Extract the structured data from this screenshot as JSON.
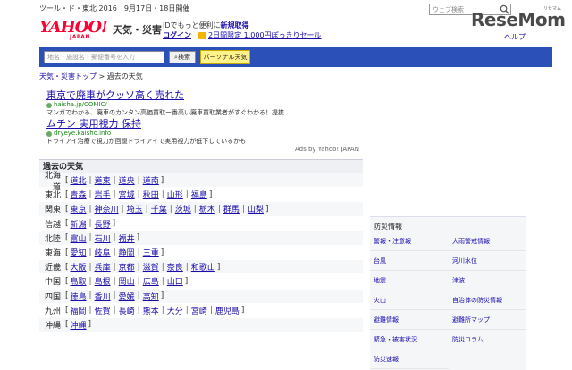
{
  "header": {
    "promo_line": "ツール・ド・東北 2016　9月17日・18日開催",
    "search_placeholder": "ウェブ検索",
    "help": "ヘルプ",
    "logo_main": "YAHOO!",
    "logo_sub": "JAPAN",
    "site_title": "天気・災害",
    "id_promo": "IDでもっと便利に",
    "new_registration": "新規取得",
    "login": "ログイン",
    "cart_promo": "2日間限定 1,000円ぽっきりセール",
    "watermark": "ReseMom",
    "watermark_ruby": "リセマム"
  },
  "nav": {
    "input_placeholder": "地名・施設名・郵便番号を入力",
    "search_button": "検索",
    "personal_button": "パーソナル天気"
  },
  "breadcrumb": {
    "top": "天気・災害トップ",
    "separator": ">",
    "current": "過去の天気"
  },
  "ads": [
    {
      "title": "東京で廃車がクッソ高く売れた",
      "url": "haisha.jp/COMIC/",
      "desc": "マンガでわかる、廃車のカンタン高価買取ー番高い廃車買取業者がすぐわかる！提携"
    },
    {
      "title": "ムチン 実用視力 保持",
      "url": "dryeye.kaisho.info",
      "desc": "ドライアイ治療で視力が回復ドライアイで実用視力が低下しているかも"
    }
  ],
  "ads_by": "Ads by Yahoo! JAPAN",
  "past_weather": {
    "title": "過去の天気",
    "regions": [
      {
        "name": "北海道",
        "prefs": [
          "道北",
          "道東",
          "道央",
          "道南"
        ]
      },
      {
        "name": "東北",
        "prefs": [
          "青森",
          "岩手",
          "宮城",
          "秋田",
          "山形",
          "福島"
        ]
      },
      {
        "name": "関東",
        "prefs": [
          "東京",
          "神奈川",
          "埼玉",
          "千葉",
          "茨城",
          "栃木",
          "群馬",
          "山梨"
        ]
      },
      {
        "name": "信越",
        "prefs": [
          "新潟",
          "長野"
        ]
      },
      {
        "name": "北陸",
        "prefs": [
          "富山",
          "石川",
          "福井"
        ]
      },
      {
        "name": "東海",
        "prefs": [
          "愛知",
          "岐阜",
          "静岡",
          "三重"
        ]
      },
      {
        "name": "近畿",
        "prefs": [
          "大阪",
          "兵庫",
          "京都",
          "滋賀",
          "奈良",
          "和歌山"
        ]
      },
      {
        "name": "中国",
        "prefs": [
          "鳥取",
          "島根",
          "岡山",
          "広島",
          "山口"
        ]
      },
      {
        "name": "四国",
        "prefs": [
          "徳島",
          "香川",
          "愛媛",
          "高知"
        ]
      },
      {
        "name": "九州",
        "prefs": [
          "福岡",
          "佐賀",
          "長崎",
          "熊本",
          "大分",
          "宮崎",
          "鹿児島"
        ]
      },
      {
        "name": "沖縄",
        "prefs": [
          "沖縄"
        ]
      }
    ]
  },
  "disaster_info": {
    "title": "防災情報",
    "items": [
      "警報・注意報",
      "大雨警戒情報",
      "台風",
      "河川水位",
      "地震",
      "津波",
      "火山",
      "自治体の防災情報",
      "避難情報",
      "避難所マップ",
      "緊急・被害状況",
      "防災コラム",
      "防災速報"
    ]
  },
  "colors": {
    "nav_bg": "#2b50b8",
    "link": "#1a0dab",
    "logo_red": "#ff0033",
    "personal_btn": "#fff38a"
  }
}
